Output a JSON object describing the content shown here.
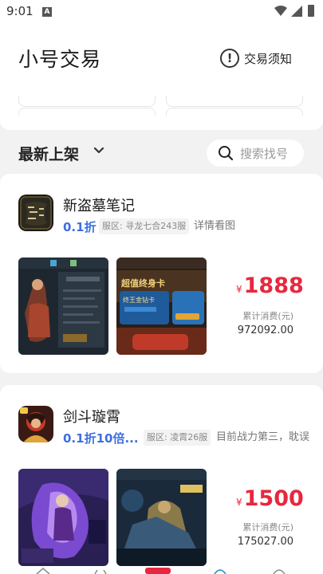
{
  "status": {
    "time": "9:01",
    "notif": "A"
  },
  "header": {
    "title": "小号交易",
    "notice_label": "交易须知"
  },
  "section": {
    "title": "最新上架"
  },
  "search": {
    "placeholder": "搜索找号"
  },
  "listings": [
    {
      "name": "新盗墓笔记",
      "discount": "0.1折",
      "server": "服区: 寻龙七合243服",
      "desc": "详情看图",
      "price_symbol": "¥",
      "price": "1888",
      "spent_label": "累计消费(元)",
      "spent_value": "972092.00",
      "shot2_text1": "超值终身卡",
      "shot2_text2": "终王金钻卡"
    },
    {
      "name": "剑斗璇霄",
      "discount": "0.1折10倍...",
      "server": "服区: 凌霄26服",
      "desc": "目前战力第三，耽误",
      "price_symbol": "¥",
      "price": "1500",
      "spent_label": "累计消费(元)",
      "spent_value": "175027.00"
    }
  ],
  "colors": {
    "accent_blue": "#3d6fe0",
    "price_red": "#e8273e"
  }
}
